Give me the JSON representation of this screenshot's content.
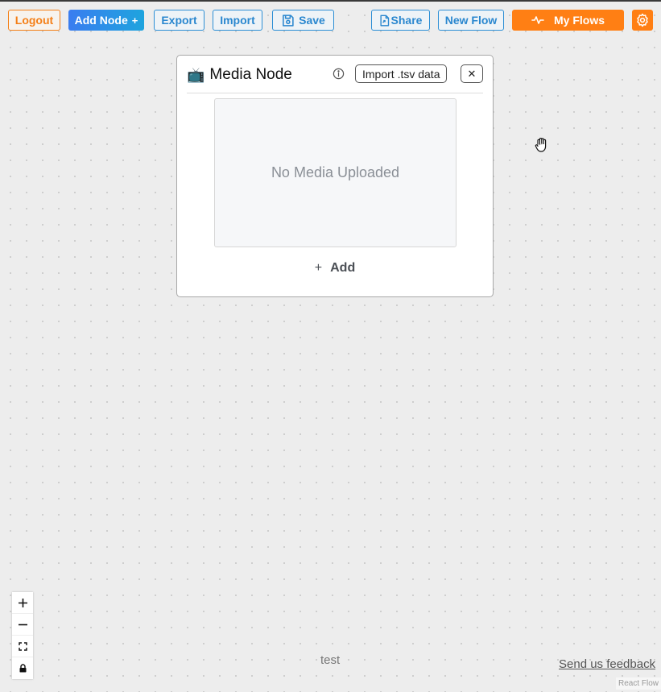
{
  "toolbar": {
    "logout_label": "Logout",
    "add_node_label": "Add Node",
    "add_node_suffix": "+",
    "export_label": "Export",
    "import_label": "Import",
    "save_label": "Save",
    "share_label": "Share",
    "new_flow_label": "New Flow",
    "my_flows_label": "My Flows",
    "icons": {
      "save": "floppy-disk-icon",
      "share": "document-share-icon",
      "my_flows": "waveform-icon",
      "settings": "gear-icon"
    }
  },
  "media_node": {
    "emoji": "📺",
    "title": "Media Node",
    "import_tsv_label": "Import .tsv data",
    "close_label": "✕",
    "empty_text": "No Media Uploaded",
    "add_plus": "+",
    "add_label": "Add"
  },
  "controls": {
    "items": [
      "zoom-in-icon",
      "zoom-out-icon",
      "fit-view-icon",
      "lock-icon"
    ]
  },
  "footer": {
    "flow_name": "test",
    "feedback_label": "Send us feedback",
    "attribution": "React Flow"
  },
  "colors": {
    "accent_orange": "#ff7f14",
    "accent_blue": "#2a87cf",
    "canvas_bg": "#ededed"
  }
}
